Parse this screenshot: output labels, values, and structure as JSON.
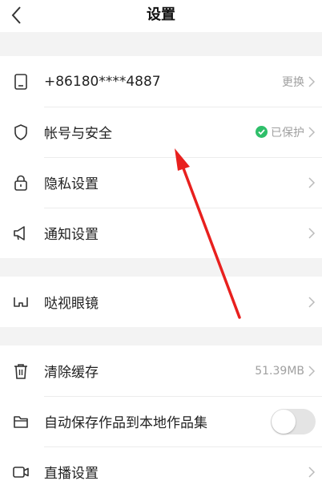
{
  "header": {
    "title": "设置",
    "back_icon": "chevron-left-icon"
  },
  "group1": {
    "phone": {
      "label": "+86180****4887",
      "action": "更换",
      "icon": "phone-icon"
    },
    "account": {
      "label": "帐号与安全",
      "status": "已保护",
      "status_color": "#2fbf6a",
      "icon": "shield-icon"
    },
    "privacy": {
      "label": "隐私设置",
      "icon": "lock-icon"
    },
    "notify": {
      "label": "通知设置",
      "icon": "megaphone-icon"
    }
  },
  "group2": {
    "glasses": {
      "label": "哒视眼镜",
      "icon": "glasses-icon"
    }
  },
  "group3": {
    "cache": {
      "label": "清除缓存",
      "size": "51.39MB",
      "icon": "trash-icon"
    },
    "autosave": {
      "label": "自动保存作品到本地作品集",
      "toggle_on": false,
      "icon": "folder-icon"
    },
    "live": {
      "label": "直播设置",
      "icon": "camera-icon"
    }
  },
  "annotation": {
    "arrow_color": "#e8201e",
    "icon": "red-arrow"
  }
}
